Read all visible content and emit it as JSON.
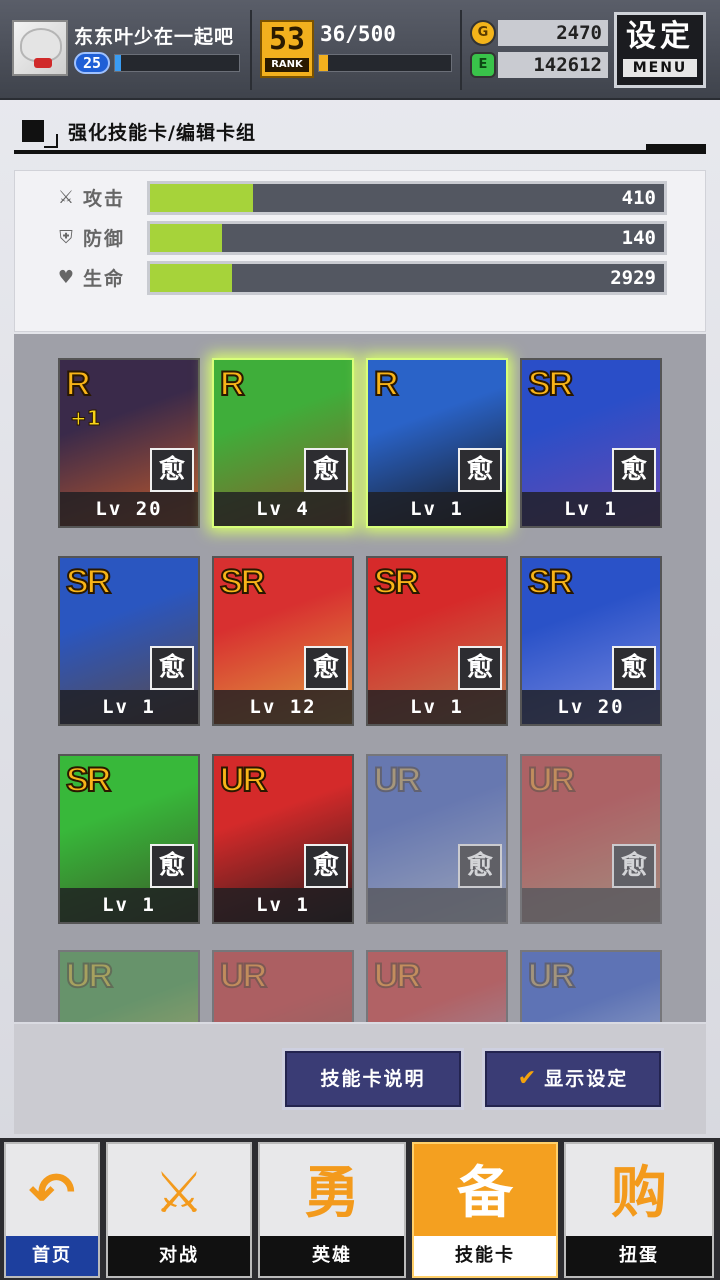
{
  "header": {
    "username": "东东叶少在一起吧",
    "player_level": "25",
    "xp_fraction": 0.05,
    "rank_number": "53",
    "rank_label": "RANK",
    "rank_progress": "36/500",
    "rank_fraction": 0.07,
    "gold": "2470",
    "gems": "142612",
    "gold_icon": "coin-icon",
    "gem_icon": "gem-icon",
    "settings_label": "设定",
    "settings_sub": "MENU"
  },
  "section": {
    "title": "强化技能卡/编辑卡组"
  },
  "stats": [
    {
      "icon": "sword-icon",
      "glyph": "⚔",
      "label": "攻击",
      "value": "410",
      "fraction": 0.2
    },
    {
      "icon": "shield-icon",
      "glyph": "⛨",
      "label": "防御",
      "value": "140",
      "fraction": 0.14
    },
    {
      "icon": "heart-icon",
      "glyph": "♥",
      "label": "生命",
      "value": "2929",
      "fraction": 0.16
    }
  ],
  "cards": [
    {
      "rarity": "R",
      "plus": "+1",
      "type": "愈",
      "level": "Lv 20",
      "glow": false,
      "locked": false,
      "bg": "#3a2a4a",
      "accent": "#c25a2a"
    },
    {
      "rarity": "R",
      "plus": "",
      "type": "愈",
      "level": "Lv 4",
      "glow": true,
      "locked": false,
      "bg": "#3fae3a",
      "accent": "#8b5a2a"
    },
    {
      "rarity": "R",
      "plus": "",
      "type": "愈",
      "level": "Lv 1",
      "glow": true,
      "locked": false,
      "bg": "#2a63c8",
      "accent": "#161616"
    },
    {
      "rarity": "SR",
      "plus": "",
      "type": "愈",
      "level": "Lv 1",
      "glow": false,
      "locked": false,
      "bg": "#2a4ec8",
      "accent": "#6a4ab0"
    },
    {
      "rarity": "SR",
      "plus": "",
      "type": "愈",
      "level": "Lv 1",
      "glow": false,
      "locked": false,
      "bg": "#2a56c0",
      "accent": "#5a4a48"
    },
    {
      "rarity": "SR",
      "plus": "",
      "type": "愈",
      "level": "Lv 12",
      "glow": false,
      "locked": false,
      "bg": "#d83030",
      "accent": "#e0a040"
    },
    {
      "rarity": "SR",
      "plus": "",
      "type": "愈",
      "level": "Lv 1",
      "glow": false,
      "locked": false,
      "bg": "#d62a2a",
      "accent": "#c08050"
    },
    {
      "rarity": "SR",
      "plus": "",
      "type": "愈",
      "level": "Lv 20",
      "glow": false,
      "locked": false,
      "bg": "#2a52c8",
      "accent": "#7a8ae0"
    },
    {
      "rarity": "SR",
      "plus": "",
      "type": "愈",
      "level": "Lv 1",
      "glow": false,
      "locked": false,
      "bg": "#38b83a",
      "accent": "#3a5a28"
    },
    {
      "rarity": "UR",
      "plus": "",
      "type": "愈",
      "level": "Lv 1",
      "glow": false,
      "locked": false,
      "bg": "#d42a2a",
      "accent": "#2a1a1a"
    },
    {
      "rarity": "UR",
      "plus": "",
      "type": "愈",
      "level": "",
      "glow": false,
      "locked": true,
      "bg": "#3a58b8",
      "accent": "#9aa8c8"
    },
    {
      "rarity": "UR",
      "plus": "",
      "type": "愈",
      "level": "",
      "glow": false,
      "locked": true,
      "bg": "#b83030",
      "accent": "#a88060"
    },
    {
      "rarity": "UR",
      "plus": "",
      "type": "",
      "level": "",
      "glow": false,
      "locked": true,
      "bg": "#3a8a3a",
      "accent": "#c8b040"
    },
    {
      "rarity": "UR",
      "plus": "",
      "type": "",
      "level": "",
      "glow": false,
      "locked": true,
      "bg": "#b82a2a",
      "accent": "#6a3a2a"
    },
    {
      "rarity": "UR",
      "plus": "",
      "type": "",
      "level": "",
      "glow": false,
      "locked": true,
      "bg": "#c03030",
      "accent": "#8aa0c0"
    },
    {
      "rarity": "UR",
      "plus": "",
      "type": "",
      "level": "",
      "glow": false,
      "locked": true,
      "bg": "#2a50c0",
      "accent": "#c8d8f0"
    }
  ],
  "actions": {
    "card_info": "技能卡说明",
    "display_settings": "显示设定",
    "check_icon": "check-icon"
  },
  "nav": [
    {
      "key": "home",
      "label": "首页",
      "glyph": "↶",
      "icon": "return-icon",
      "active": false
    },
    {
      "key": "battle",
      "label": "对战",
      "glyph": "⚔",
      "icon": "gamepad-icon",
      "active": false
    },
    {
      "key": "hero",
      "label": "英雄",
      "glyph": "勇",
      "icon": "hero-icon",
      "active": false
    },
    {
      "key": "cards",
      "label": "技能卡",
      "glyph": "备",
      "icon": "cards-icon",
      "active": true
    },
    {
      "key": "gacha",
      "label": "扭蛋",
      "glyph": "购",
      "icon": "gacha-icon",
      "active": false
    }
  ]
}
